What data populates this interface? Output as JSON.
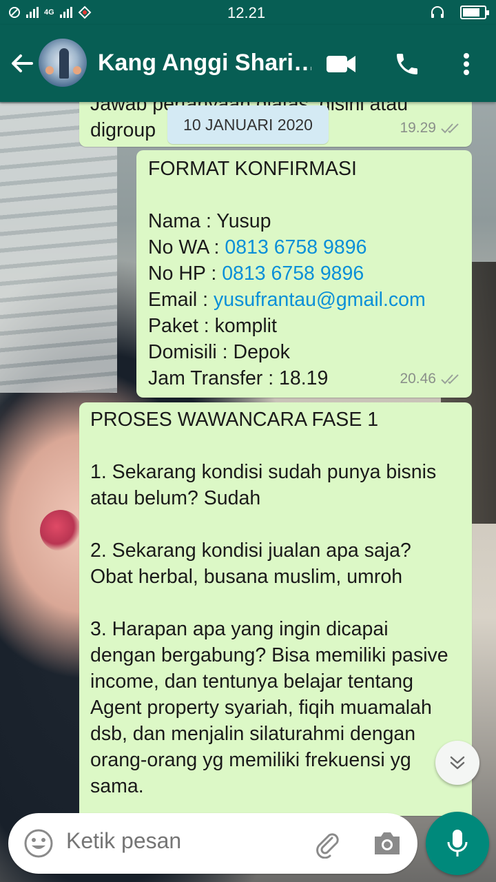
{
  "status_bar": {
    "time": "12.21",
    "network_label": "4G",
    "icons": [
      "wifi-icon",
      "signal-icon",
      "data-icon",
      "headset-icon",
      "battery-icon"
    ],
    "battery_fraction": 0.8
  },
  "header": {
    "title": "Kang Anggi Shari…",
    "icons": [
      "back-arrow-icon",
      "avatar",
      "video-call-icon",
      "phone-icon",
      "more-vert-icon"
    ]
  },
  "date_chip": "10 JANUARI 2020",
  "messages": [
    {
      "partial_text": "Jawab pertanyaan diatas, disini atau",
      "text": "digroup",
      "time": "19.29",
      "status": "read-ticks"
    },
    {
      "lines": {
        "heading": "FORMAT KONFIRMASI",
        "name": "Nama : Yusup",
        "wa_label": "No WA : ",
        "wa_value": "0813 6758 9896",
        "hp_label": "No HP : ",
        "hp_value": "0813 6758 9896",
        "email_label": "Email : ",
        "email_value": "yusufrantau@gmail.com",
        "paket": "Paket : komplit",
        "domisili": "Domisili : Depok",
        "jam": "Jam Transfer : 18.19"
      },
      "time": "20.46",
      "status": "read-ticks"
    },
    {
      "text": "PROSES WAWANCARA FASE 1\n\n1. Sekarang kondisi sudah punya bisnis atau belum? Sudah\n\n2. Sekarang kondisi jualan apa saja? Obat herbal, busana muslim, umroh\n\n3. Harapan apa yang ingin dicapai dengan bergabung? Bisa memiliki pasive income, dan tentunya belajar tentang Agent property syariah, fiqih muamalah dsb, dan menjalin silaturahmi dengan orang-orang yg memiliki frekuensi yg sama."
    }
  ],
  "composer": {
    "placeholder": "Ketik pesan",
    "icons": [
      "emoji-icon",
      "attach-icon",
      "camera-icon",
      "mic-icon"
    ]
  },
  "colors": {
    "header": "#075e54",
    "bubble_out": "#dcf8c6",
    "link": "#0a8fd8",
    "date_chip": "#d4eaf4",
    "mic_button": "#00897b"
  }
}
